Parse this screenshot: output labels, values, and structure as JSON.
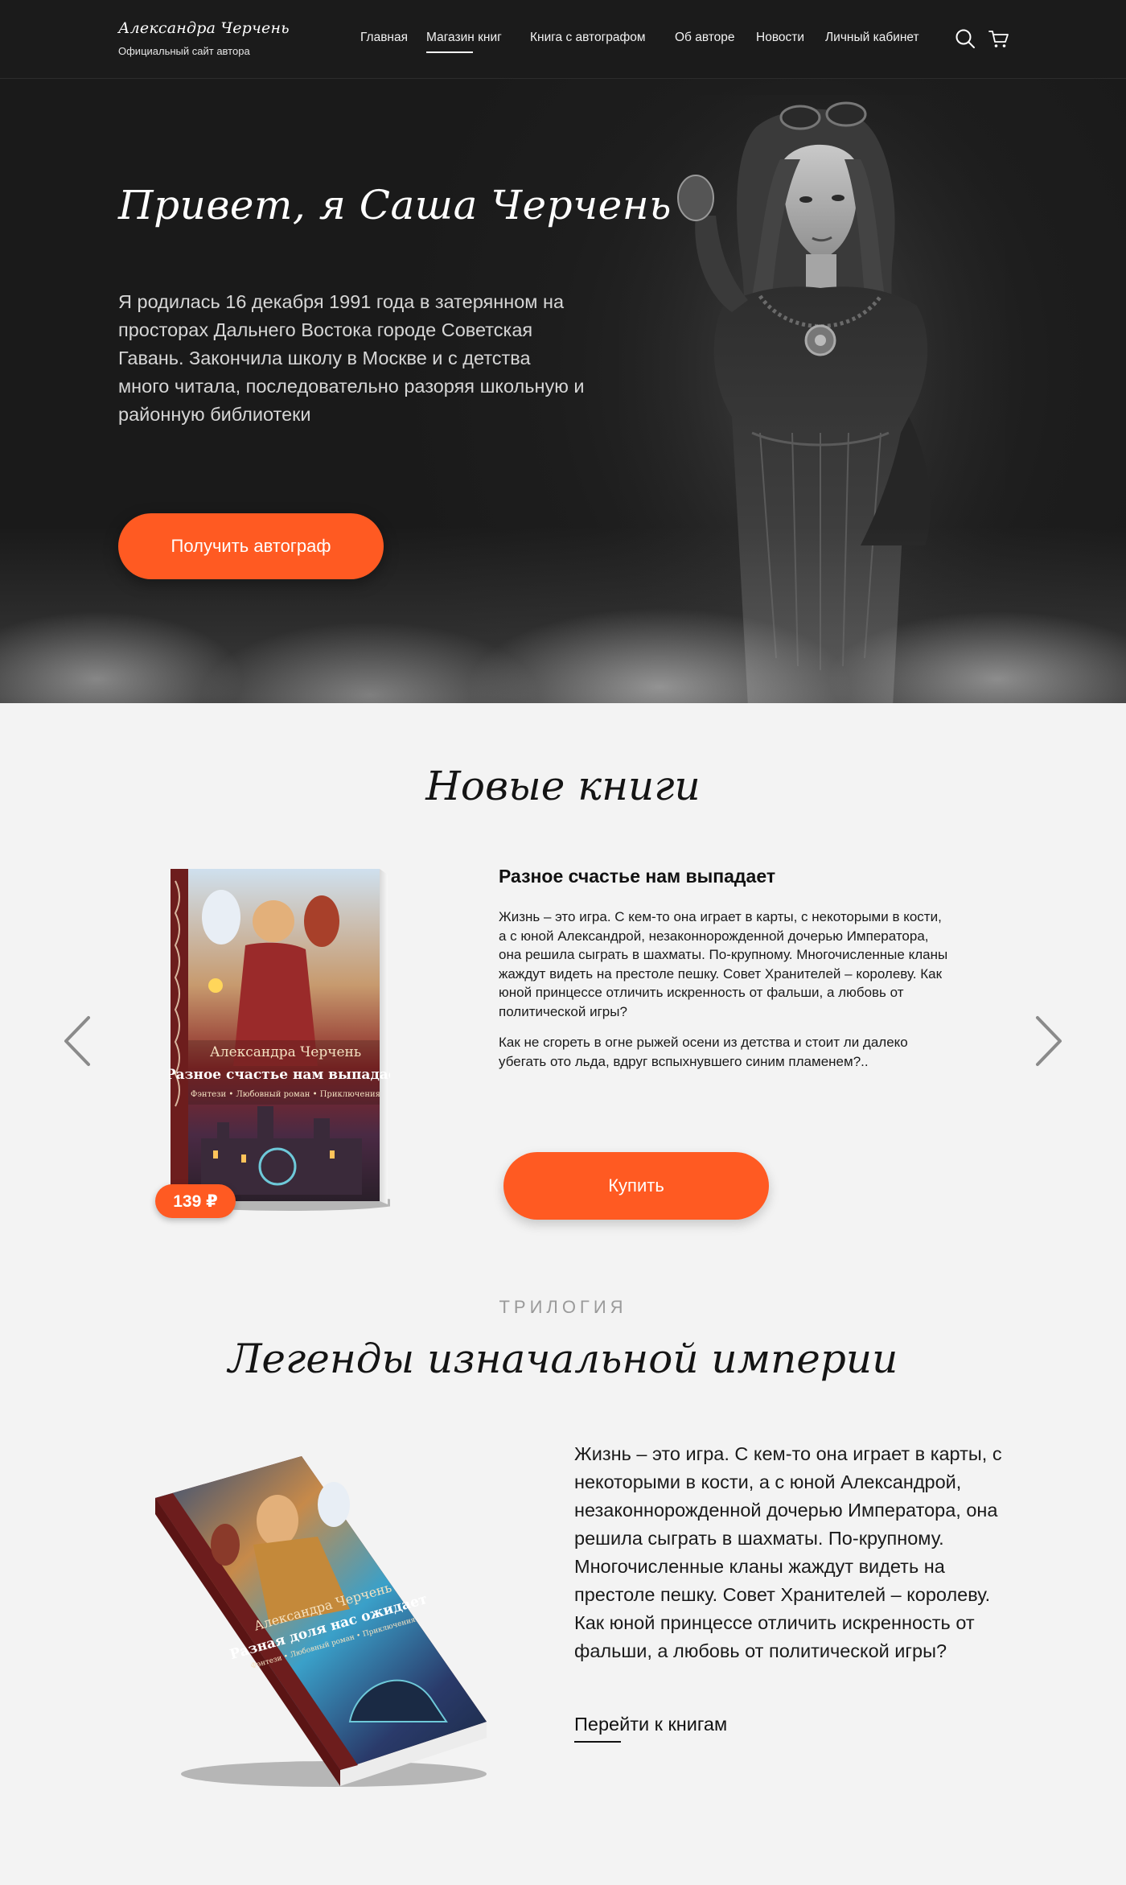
{
  "header": {
    "logo_name": "Александра Черчень",
    "logo_subtitle": "Официальный сайт автора",
    "nav": [
      {
        "label": "Главная"
      },
      {
        "label": "Магазин книг",
        "active": true
      },
      {
        "label": "Книга с автографом"
      },
      {
        "label": "Об авторе"
      },
      {
        "label": "Новости"
      },
      {
        "label": "Личный кабинет"
      }
    ],
    "icons": [
      "search-icon",
      "cart-icon"
    ]
  },
  "hero": {
    "title": "Привет, я Саша Черчень",
    "text": "Я родилась 16 декабря 1991 года в затерянном на просторах Дальнего Востока городе Советская Гавань. Закончила школу в Москве и с детства много читала, последовательно разоряя школьную и районную библиотеки",
    "button": "Получить автограф"
  },
  "new_books": {
    "title": "Новые книги",
    "book": {
      "title": "Разное счастье нам выпадает",
      "cover_author": "Александра Черчень",
      "cover_title": "Разное счастье нам выпадает",
      "cover_genres": "Фэнтези • Любовный роман • Приключения",
      "price": "139 ₽",
      "desc_1": "Жизнь – это игра. С кем-то она играет в карты, с некоторыми в кости,  а с юной Александрой, незаконнорожденной дочерью Императора, она решила сыграть в шахматы. По-крупному. Многочисленные кланы жаждут видеть на престоле пешку. Совет Хранителей – королеву. Как юной принцессе отличить искренность от фальши, а любовь от политической игры?",
      "desc_2": "Как не сгореть в огне рыжей осени из детства и стоит ли далеко убегать ото льда, вдруг вспыхнувшего синим пламенем?..",
      "buy_button": "Купить"
    }
  },
  "trilogy": {
    "kicker": "ТРИЛОГИЯ",
    "title": "Легенды изначальной империи",
    "cover_author": "Александра Черчень",
    "cover_title": "Разная доля нас ожидает",
    "cover_genres": "Фэнтези • Любовный роман • Приключения",
    "text": "Жизнь – это игра. С кем-то она играет в карты, с некоторыми в кости,  а с юной Александрой, незаконнорожденной дочерью Императора, она решила сыграть в шахматы. По-крупному. Многочисленные кланы жаждут видеть на престоле пешку. Совет Хранителей – королеву. Как юной принцессе отличить искренность от фальши, а любовь от политической игры?",
    "link": "Перейти к книгам"
  },
  "colors": {
    "accent": "#ff5a22",
    "header_bg": "#1b1b1b",
    "hero_bg": "#1d1d1d",
    "page_bg": "#f3f3f3"
  }
}
